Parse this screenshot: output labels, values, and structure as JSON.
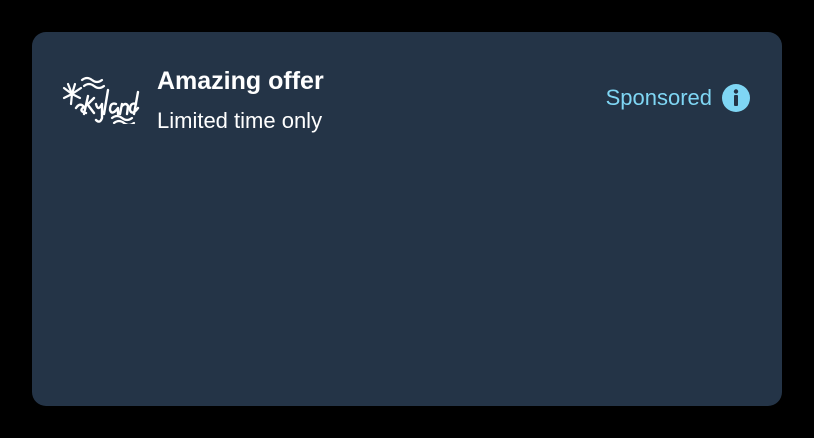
{
  "ad": {
    "brand_logo_icon": "skyland-logo",
    "title": "Amazing offer",
    "subtitle": "Limited time only",
    "sponsored_label": "Sponsored",
    "info_icon": "info-icon"
  },
  "colors": {
    "background": "#000000",
    "card": "#243447",
    "accent": "#7FD6F4",
    "text": "#ffffff"
  }
}
